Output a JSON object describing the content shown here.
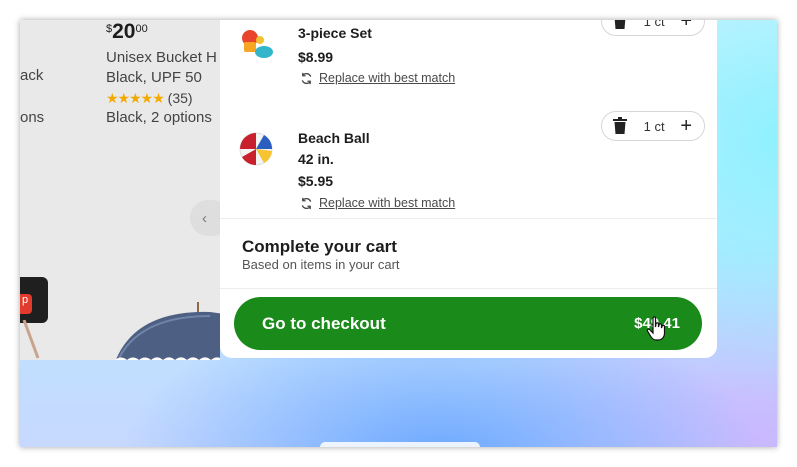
{
  "background_page": {
    "product": {
      "price_currency": "$",
      "price_dollars": "20",
      "price_cents": "00",
      "title_line1": "Unisex Bucket H",
      "title_line2": "Black, UPF 50",
      "stars": "★★★★★",
      "review_count": "(35)",
      "options": "Black, 2 options"
    },
    "left_fragments": [
      "ack",
      "ons"
    ],
    "carousel_prev": "‹",
    "badge_text": "p"
  },
  "cart": {
    "items": [
      {
        "name": "3-piece Set",
        "price": "$8.99",
        "replace_label": "Replace with best match",
        "quantity": "1 ct"
      },
      {
        "name_line1": "Beach Ball",
        "name_line2": "42 in.",
        "price": "$5.95",
        "replace_label": "Replace with best match",
        "quantity": "1 ct"
      }
    ],
    "complete_title": "Complete your cart",
    "complete_subtitle": "Based on items in your cart",
    "checkout_label": "Go to checkout",
    "checkout_total": "$49.41"
  },
  "colors": {
    "checkout_green": "#1a8a1a",
    "panel_bg": "#ffffff",
    "star_color": "#f2a900"
  }
}
